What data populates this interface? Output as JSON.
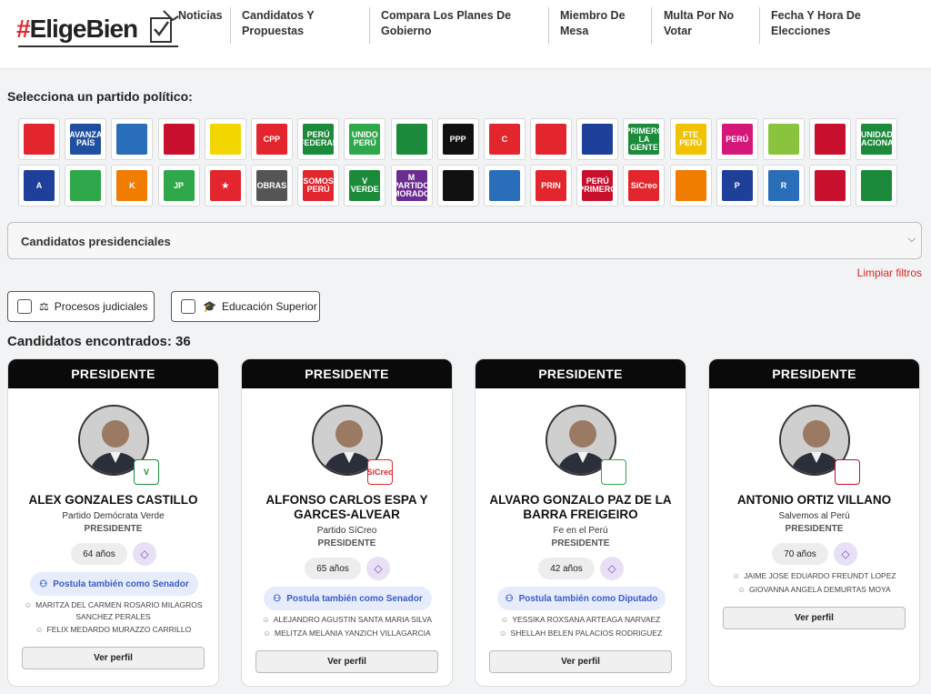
{
  "brand": {
    "logo_text": "#EligeBien"
  },
  "nav": [
    {
      "label": "Noticias"
    },
    {
      "label": "Candidatos Y Propuestas"
    },
    {
      "label": "Compara Los Planes De Gobierno"
    },
    {
      "label": "Miembro De Mesa"
    },
    {
      "label": "Multa Por No Votar"
    },
    {
      "label": "Fecha Y Hora De Elecciones"
    }
  ],
  "party_section": {
    "title": "Selecciona un partido político:"
  },
  "parties": [
    {
      "text": "",
      "color": "#e3262e"
    },
    {
      "text": "AVANZA PAÍS",
      "color": "#1f4fa0"
    },
    {
      "text": "",
      "color": "#2a6db8"
    },
    {
      "text": "",
      "color": "#c8102e"
    },
    {
      "text": "",
      "color": "#f2d600"
    },
    {
      "text": "CPP",
      "color": "#e3262e"
    },
    {
      "text": "PERÚ FEDERAL",
      "color": "#1b8a3a"
    },
    {
      "text": "UNIDO PERÚ",
      "color": "#2ea84a"
    },
    {
      "text": "",
      "color": "#1b8a3a"
    },
    {
      "text": "PPP",
      "color": "#111111"
    },
    {
      "text": "C",
      "color": "#e3262e"
    },
    {
      "text": "",
      "color": "#e3262e"
    },
    {
      "text": "",
      "color": "#1e3f9a"
    },
    {
      "text": "PRIMERO LA GENTE",
      "color": "#1b8a3a"
    },
    {
      "text": "FTE PERÚ",
      "color": "#f2c200"
    },
    {
      "text": "PERÚ",
      "color": "#d6177a"
    },
    {
      "text": "",
      "color": "#8ac43f"
    },
    {
      "text": "",
      "color": "#c8102e"
    },
    {
      "text": "UNIDAD NACIONAL",
      "color": "#1b8a3a"
    },
    {
      "text": "A",
      "color": "#1e3f9a"
    },
    {
      "text": "",
      "color": "#2ea84a"
    },
    {
      "text": "K",
      "color": "#f07c00"
    },
    {
      "text": "JP",
      "color": "#2ea84a"
    },
    {
      "text": "★",
      "color": "#e3262e"
    },
    {
      "text": "OBRAS",
      "color": "#555555"
    },
    {
      "text": "SOMOS PERÚ",
      "color": "#e3262e"
    },
    {
      "text": "V VERDE",
      "color": "#1b8a3a"
    },
    {
      "text": "M PARTIDO MORADO",
      "color": "#6b2c91"
    },
    {
      "text": "",
      "color": "#111111"
    },
    {
      "text": "",
      "color": "#2a6db8"
    },
    {
      "text": "PRIN",
      "color": "#e3262e"
    },
    {
      "text": "PERÚ PRIMERO",
      "color": "#c8102e"
    },
    {
      "text": "SíCreo",
      "color": "#e3262e"
    },
    {
      "text": "",
      "color": "#f07c00"
    },
    {
      "text": "P",
      "color": "#1e3f9a"
    },
    {
      "text": "R",
      "color": "#2a6db8"
    },
    {
      "text": "",
      "color": "#c8102e"
    },
    {
      "text": "",
      "color": "#1b8a3a"
    }
  ],
  "filter_select": {
    "label": "Candidatos presidenciales"
  },
  "clear_filters": "Limpiar filtros",
  "chips": [
    {
      "label": "Procesos judiciales",
      "icon": "⚖"
    },
    {
      "label": "Educación Superior",
      "icon": "🎓"
    }
  ],
  "results": {
    "count_label": "Candidatos encontrados: 36"
  },
  "cards": [
    {
      "header": "PRESIDENTE",
      "name": "ALEX GONZALES CASTILLO",
      "party": "Partido Demócrata Verde",
      "role": "PRESIDENTE",
      "age": "64 años",
      "also": "Postula también como Senador",
      "running_mates": [
        "MARITZA DEL CARMEN ROSARIO MILAGROS SANCHEZ PERALES",
        "FELIX MEDARDO MURAZZO CARRILLO"
      ],
      "button": "Ver perfil",
      "badge_color": "#1b8a3a",
      "badge_text": "V"
    },
    {
      "header": "PRESIDENTE",
      "name": "ALFONSO CARLOS ESPA Y GARCES-ALVEAR",
      "party": "Partido SíCreo",
      "role": "PRESIDENTE",
      "age": "65 años",
      "also": "Postula también como Senador",
      "running_mates": [
        "ALEJANDRO AGUSTIN SANTA MARIA SILVA",
        "MELITZA MELANIA YANZICH VILLAGARCIA"
      ],
      "button": "Ver perfil",
      "badge_color": "#e3262e",
      "badge_text": "SíCreo"
    },
    {
      "header": "PRESIDENTE",
      "name": "ALVARO GONZALO PAZ DE LA BARRA FREIGEIRO",
      "party": "Fe en el Perú",
      "role": "PRESIDENTE",
      "age": "42 años",
      "also": "Postula también como Diputado",
      "running_mates": [
        "YESSIKA ROXSANA ARTEAGA NARVAEZ",
        "SHELLAH BELEN PALACIOS RODRIGUEZ"
      ],
      "button": "Ver perfil",
      "badge_color": "#2ea84a",
      "badge_text": ""
    },
    {
      "header": "PRESIDENTE",
      "name": "ANTONIO ORTIZ VILLANO",
      "party": "Salvemos al Perú",
      "role": "PRESIDENTE",
      "age": "70 años",
      "also": "",
      "running_mates": [
        "JAIME JOSE EDUARDO FREUNDT LOPEZ",
        "GIOVANNA ANGELA DEMURTAS MOYA"
      ],
      "button": "Ver perfil",
      "badge_color": "#c8102e",
      "badge_text": ""
    }
  ]
}
